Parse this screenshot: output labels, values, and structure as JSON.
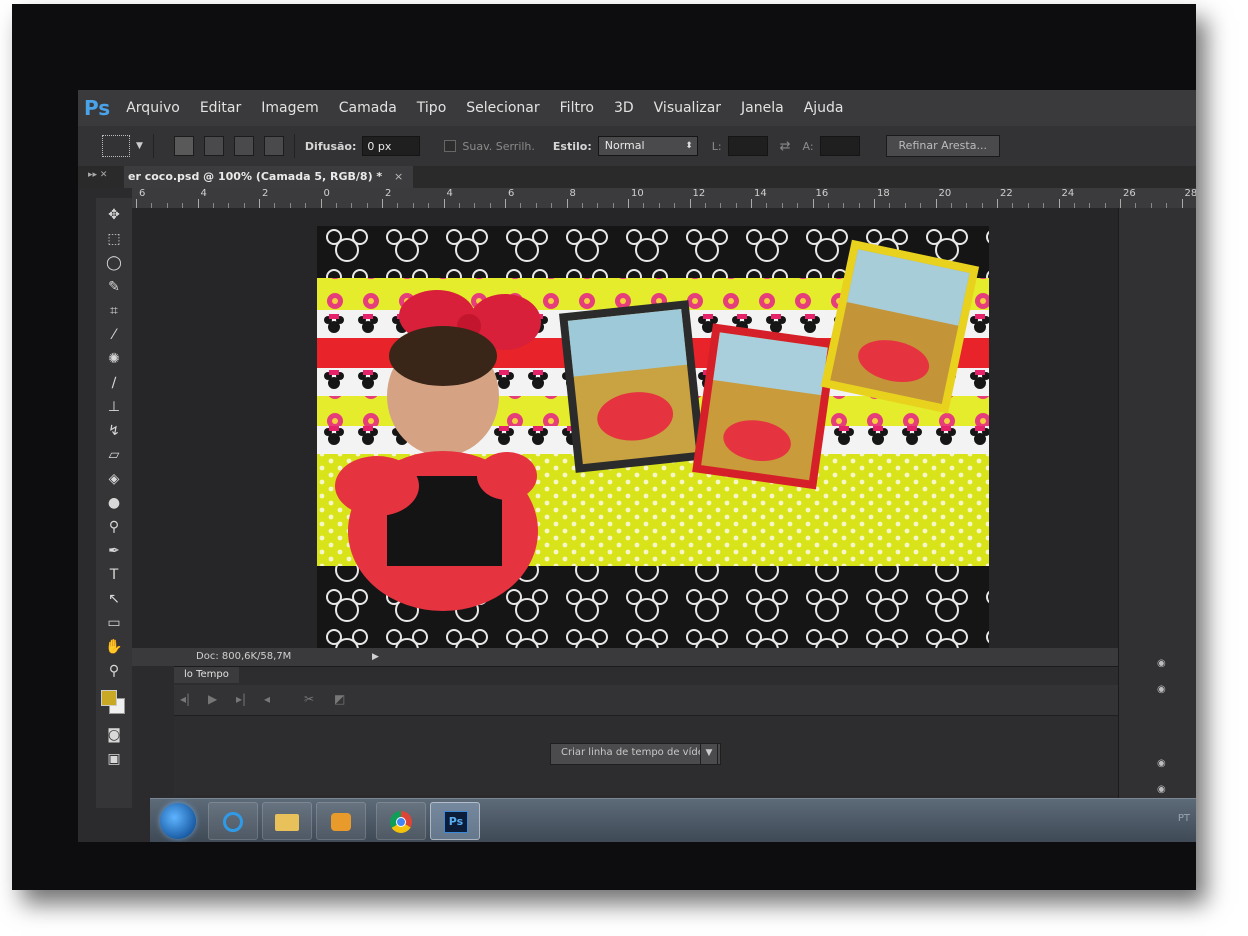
{
  "app": {
    "logo": "Ps",
    "menu": [
      "Arquivo",
      "Editar",
      "Imagem",
      "Camada",
      "Tipo",
      "Selecionar",
      "Filtro",
      "3D",
      "Visualizar",
      "Janela",
      "Ajuda"
    ]
  },
  "options": {
    "feather_label": "Difusão:",
    "feather_value": "0 px",
    "antialias_label": "Suav. Serrilh.",
    "style_label": "Estilo:",
    "style_value": "Normal",
    "width_label": "L:",
    "height_label": "A:",
    "refine_button": "Refinar Aresta..."
  },
  "document": {
    "tab_title": "er coco.psd @ 100% (Camada 5, RGB/8) *",
    "close": "×",
    "status": "Doc: 800,6K/58,7M"
  },
  "ruler": {
    "labels": [
      "6",
      "4",
      "2",
      "0",
      "2",
      "4",
      "6",
      "8",
      "10",
      "12",
      "14",
      "16",
      "18",
      "20",
      "22",
      "24",
      "26",
      "28"
    ]
  },
  "timeline": {
    "tab": "lo Tempo",
    "create_button": "Criar linha de tempo de vídeo"
  },
  "taskbar": {
    "ps_label": "Ps",
    "tray": "PT"
  },
  "colors": {
    "foreground": "#c8a824",
    "background": "#f0f0f0"
  }
}
